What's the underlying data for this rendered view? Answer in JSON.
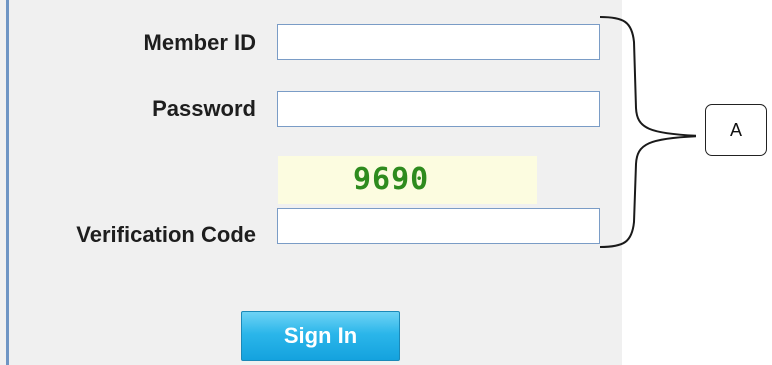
{
  "form": {
    "member_id_label": "Member ID",
    "member_id_value": "",
    "password_label": "Password",
    "password_value": "",
    "captcha_text": "9690",
    "verification_label": "Verification Code",
    "verification_value": "",
    "sign_in_label": "Sign In"
  },
  "annotation": {
    "callout_label": "A"
  },
  "colors": {
    "panel_background": "#f0f0f0",
    "panel_border": "#6f95c4",
    "input_border": "#7a9cc6",
    "captcha_background": "#fcfce0",
    "captcha_text": "#2e8b1e",
    "button_accent": "#2bb6ea"
  }
}
